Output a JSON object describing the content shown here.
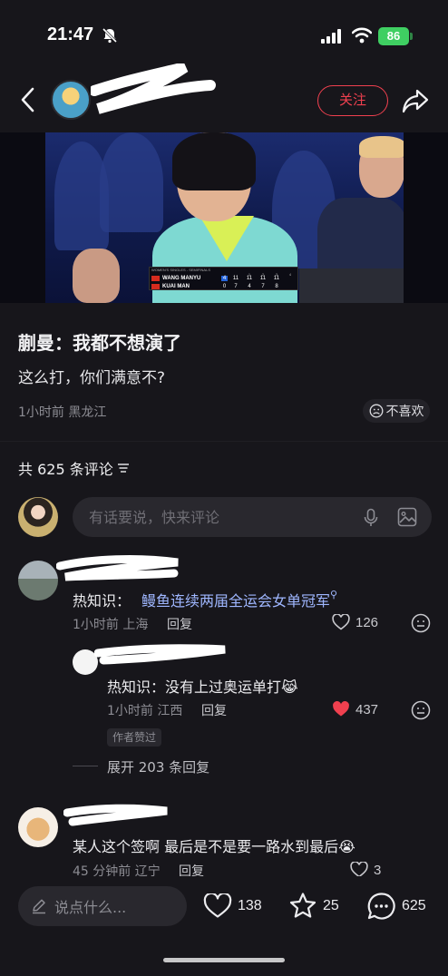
{
  "status_bar": {
    "time": "21:47",
    "battery": "86"
  },
  "header": {
    "follow_label": "关注"
  },
  "video": {
    "scoreboard": {
      "title": "WOMEN'S SINGLES - SEMIFINALS",
      "game_headers": [
        "1",
        "2",
        "3",
        "4"
      ],
      "rows": [
        {
          "name": "WANG MANYU",
          "games": "4",
          "points": [
            "11",
            "11",
            "11",
            "11"
          ]
        },
        {
          "name": "KUAI MAN",
          "games": "0",
          "points": [
            "7",
            "4",
            "7",
            "8"
          ]
        }
      ]
    }
  },
  "post": {
    "title": "蒯曼：我都不想演了",
    "body": "这么打，你们满意不?",
    "meta": "1小时前 黑龙江",
    "dislike_label": "不喜欢"
  },
  "comments_section": {
    "count_label": "共 625 条评论",
    "input_placeholder": "有话要说，快来评论",
    "comments": [
      {
        "prefix": "热知识：",
        "link_text": "鳗鱼连续两届全运会女单冠军",
        "meta": "1小时前 上海",
        "reply_label": "回复",
        "likes": "126"
      },
      {
        "text": "热知识：没有上过奥运单打😹",
        "meta": "1小时前 江西",
        "reply_label": "回复",
        "likes": "437",
        "badge": "作者赞过"
      },
      {
        "expand_label": "展开 203 条回复"
      },
      {
        "text": "某人这个签啊 最后是不是要一路水到最后😭",
        "meta": "45 分钟前 辽宁",
        "reply_label": "回复",
        "likes": "3"
      }
    ]
  },
  "bottom_bar": {
    "say_placeholder": "说点什么...",
    "likes": "138",
    "favorites": "25",
    "comments": "625"
  },
  "colors": {
    "accent_red": "#f0404f",
    "liked_red": "#f0404f",
    "battery_green": "#3fcf62",
    "link_blue": "#9fb7ff"
  }
}
